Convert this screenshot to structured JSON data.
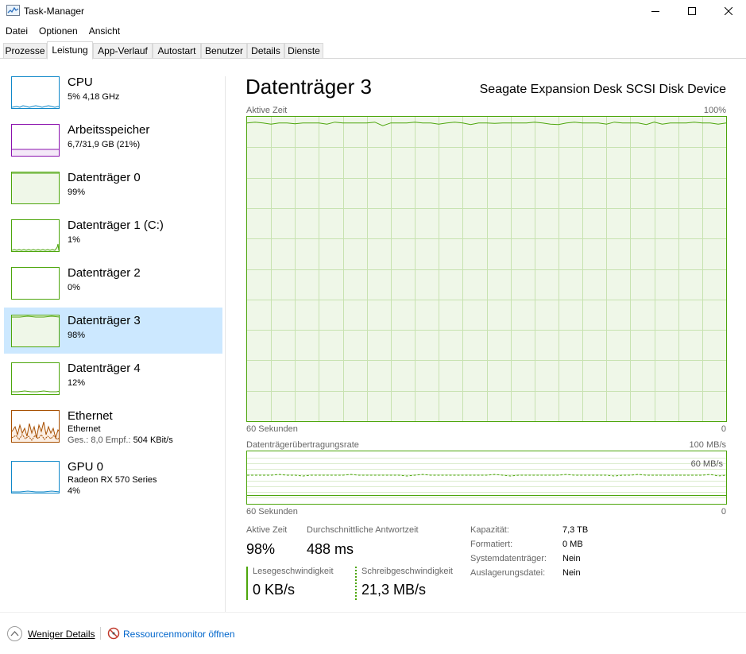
{
  "window": {
    "title": "Task-Manager",
    "minimize_glyph": "—",
    "maximize_glyph": "☐",
    "close_glyph": "✕"
  },
  "menu": [
    "Datei",
    "Optionen",
    "Ansicht"
  ],
  "tabs": [
    {
      "label": "Prozesse",
      "active": false
    },
    {
      "label": "Leistung",
      "active": true
    },
    {
      "label": "App-Verlauf",
      "active": false
    },
    {
      "label": "Autostart",
      "active": false
    },
    {
      "label": "Benutzer",
      "active": false
    },
    {
      "label": "Details",
      "active": false
    },
    {
      "label": "Dienste",
      "active": false
    }
  ],
  "sidebar": {
    "items": [
      {
        "name": "CPU",
        "line1": "5% 4,18 GHz",
        "color": "#1188c9",
        "selected": false
      },
      {
        "name": "Arbeitsspeicher",
        "line1": "6,7/31,9 GB (21%)",
        "color": "#8b12ae",
        "selected": false
      },
      {
        "name": "Datenträger 0",
        "line1": "99%",
        "color": "#4da60c",
        "selected": false
      },
      {
        "name": "Datenträger 1 (C:)",
        "line1": "1%",
        "color": "#4da60c",
        "selected": false
      },
      {
        "name": "Datenträger 2",
        "line1": "0%",
        "color": "#4da60c",
        "selected": false
      },
      {
        "name": "Datenträger 3",
        "line1": "98%",
        "color": "#4da60c",
        "selected": true
      },
      {
        "name": "Datenträger 4",
        "line1": "12%",
        "color": "#4da60c",
        "selected": false
      },
      {
        "name": "Ethernet",
        "line1": "Ethernet",
        "line2_label_a": "Ges.: 8,0",
        "line2_label_b": "Empf.:",
        "line2_value": "504 KBit/s",
        "color": "#a74f01",
        "selected": false
      },
      {
        "name": "GPU 0",
        "line1": "Radeon RX 570 Series",
        "line2": "4%",
        "color": "#1188c9",
        "selected": false
      }
    ]
  },
  "main": {
    "title": "Datenträger 3",
    "device": "Seagate Expansion Desk SCSI Disk Device",
    "active_graph": {
      "label": "Aktive Zeit",
      "max_label": "100%",
      "time_label": "60 Sekunden",
      "min_label": "0",
      "level": 0.98
    },
    "transfer_graph": {
      "label": "Datenträgerübertragungsrate",
      "max_label": "100 MB/s",
      "mid_label": "60 MB/s",
      "time_label": "60 Sekunden",
      "min_label": "0"
    },
    "stats": {
      "active_label": "Aktive Zeit",
      "active_value": "98%",
      "response_label": "Durchschnittliche Antwortzeit",
      "response_value": "488 ms",
      "read_label": "Lesegeschwindigkeit",
      "read_value": "0 KB/s",
      "write_label": "Schreibgeschwindigkeit",
      "write_value": "21,3 MB/s"
    },
    "properties": [
      {
        "label": "Kapazität:",
        "value": "7,3 TB"
      },
      {
        "label": "Formatiert:",
        "value": "0 MB"
      },
      {
        "label": "Systemdatenträger:",
        "value": "Nein"
      },
      {
        "label": "Auslagerungsdatei:",
        "value": "Nein"
      }
    ]
  },
  "footer": {
    "fewer_details": "Weniger Details",
    "resource_monitor": "Ressourcenmonitor öffnen"
  },
  "colors": {
    "disk_green": "#4da60c",
    "disk_fill": "#eff7e8",
    "selected_bg": "#cce8ff"
  }
}
